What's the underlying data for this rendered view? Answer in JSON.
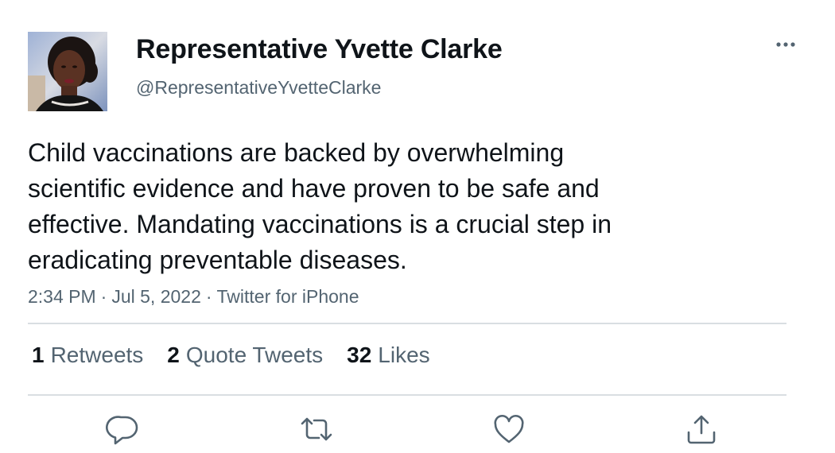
{
  "author": {
    "display_name": "Representative Yvette Clarke",
    "handle": "@RepresentativeYvetteClarke",
    "avatar_icon": "profile-photo"
  },
  "tweet": {
    "text_lines": [
      "Child vaccinations are backed by overwhelming",
      "scientific evidence and have proven to be safe and",
      "effective. Mandating vaccinations is a crucial step in",
      "eradicating preventable diseases."
    ],
    "time": "2:34 PM",
    "date": "Jul 5, 2022",
    "source": "Twitter for iPhone",
    "separator": "·"
  },
  "stats": {
    "retweets": {
      "count": "1",
      "label": "Retweets"
    },
    "quote_tweets": {
      "count": "2",
      "label": "Quote Tweets"
    },
    "likes": {
      "count": "32",
      "label": "Likes"
    }
  },
  "actions": {
    "reply_icon": "reply-icon",
    "retweet_icon": "retweet-icon",
    "like_icon": "heart-icon",
    "share_icon": "share-icon"
  },
  "colors": {
    "text_primary": "#0f1419",
    "text_secondary": "#536471",
    "divider": "#d9dee2",
    "icon": "#536471"
  }
}
